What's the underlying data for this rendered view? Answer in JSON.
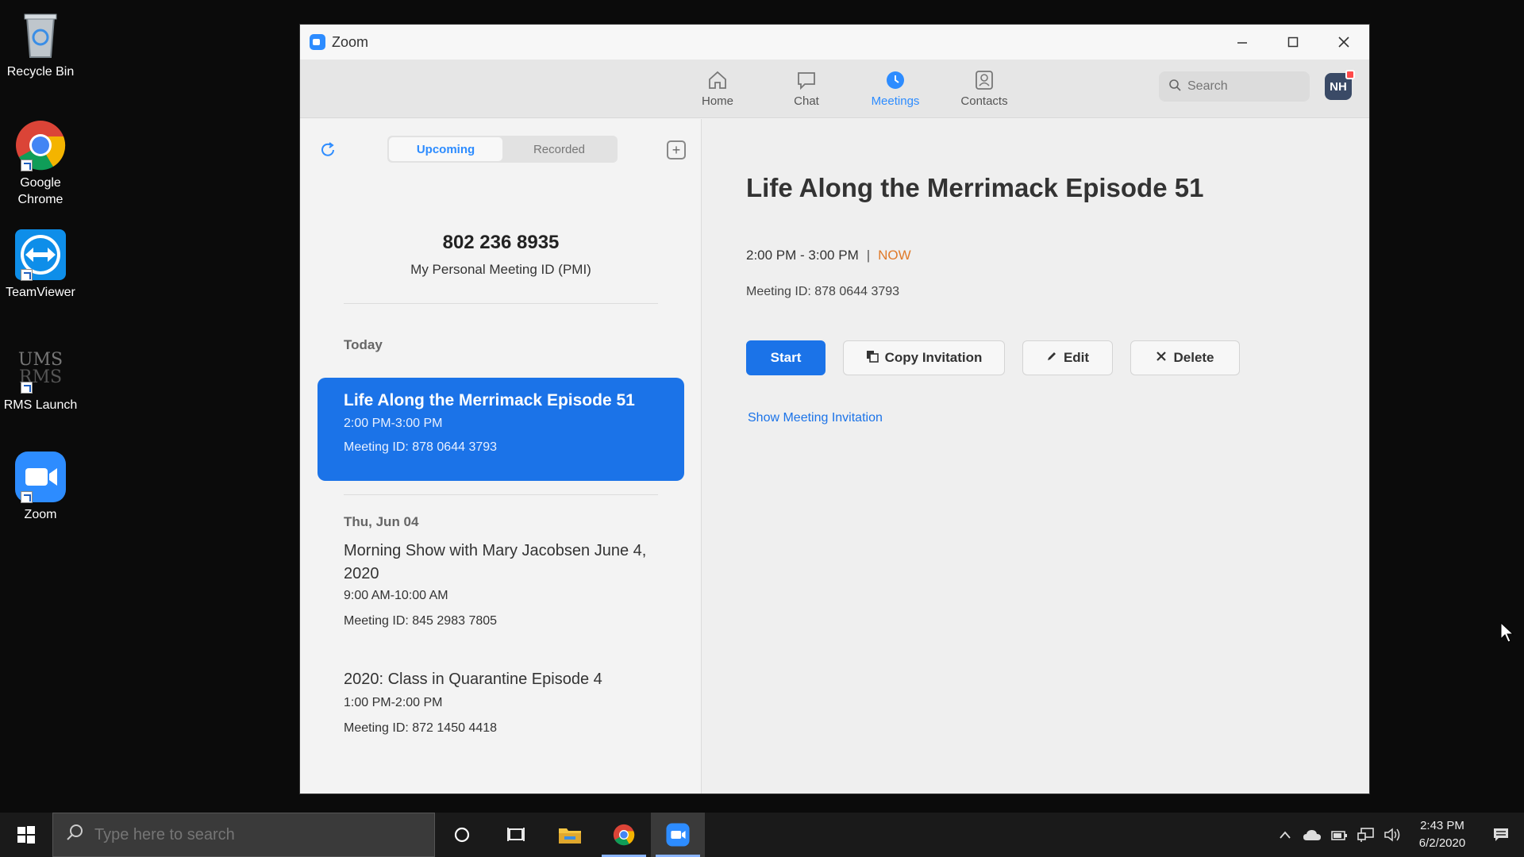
{
  "desktop": {
    "icons": [
      {
        "label": "Recycle Bin"
      },
      {
        "label": "Google Chrome"
      },
      {
        "label": "TeamViewer"
      },
      {
        "label": "RMS Launch"
      },
      {
        "label": "Zoom"
      }
    ]
  },
  "window": {
    "title": "Zoom",
    "nav": {
      "tabs": [
        {
          "label": "Home"
        },
        {
          "label": "Chat"
        },
        {
          "label": "Meetings"
        },
        {
          "label": "Contacts"
        }
      ],
      "search_placeholder": "Search",
      "avatar_initials": "NH"
    },
    "left": {
      "segments": {
        "upcoming": "Upcoming",
        "recorded": "Recorded"
      },
      "pmi_number": "802 236 8935",
      "pmi_label": "My Personal Meeting ID (PMI)",
      "today_label": "Today",
      "selected_meeting": {
        "title": "Life Along the Merrimack Episode 51",
        "time": "2:00 PM-3:00 PM",
        "meeting_id": "Meeting ID: 878 0644 3793"
      },
      "date_label": "Thu, Jun 04",
      "meetings": [
        {
          "title": "Morning Show with Mary Jacobsen June 4, 2020",
          "time": "9:00 AM-10:00 AM",
          "meeting_id": "Meeting ID: 845 2983 7805"
        },
        {
          "title": "2020: Class in Quarantine Episode 4",
          "time": "1:00 PM-2:00 PM",
          "meeting_id": "Meeting ID: 872 1450 4418"
        }
      ]
    },
    "detail": {
      "title": "Life Along the Merrimack Episode 51",
      "time": "2:00 PM - 3:00 PM",
      "separator": "|",
      "now": "NOW",
      "meeting_id": "Meeting ID: 878 0644 3793",
      "buttons": {
        "start": "Start",
        "copy": "Copy Invitation",
        "edit": "Edit",
        "delete": "Delete"
      },
      "show_invitation": "Show Meeting Invitation"
    }
  },
  "taskbar": {
    "search_placeholder": "Type here to search",
    "time": "2:43 PM",
    "date": "6/2/2020"
  },
  "colors": {
    "accent": "#1b73e8",
    "now": "#e07a2a"
  }
}
